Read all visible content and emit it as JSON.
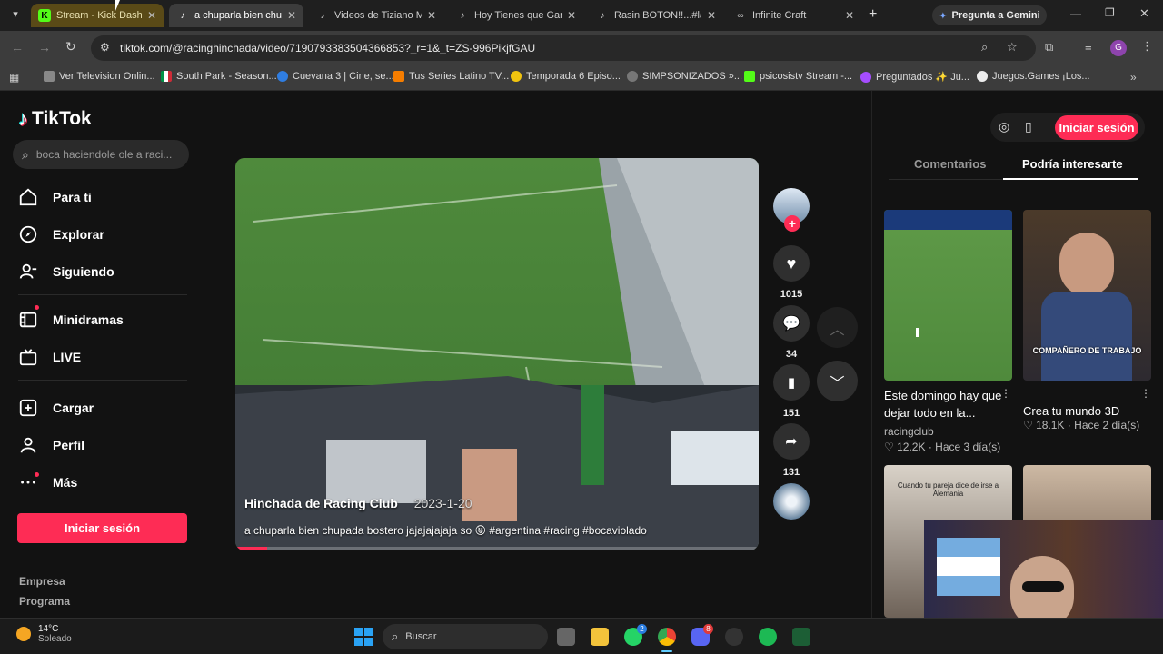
{
  "browser": {
    "tabs": [
      {
        "title": "Stream - Kick Dashbo",
        "icon": "kick-icon"
      },
      {
        "title": "a chuparla bien chup",
        "icon": "tiktok-icon"
      },
      {
        "title": "Videos de Tiziano M",
        "icon": "tiktok-icon"
      },
      {
        "title": "Hoy Tienes que Gana",
        "icon": "tiktok-icon"
      },
      {
        "title": "Rasin BOTON!!...#lat",
        "icon": "tiktok-icon"
      },
      {
        "title": "Infinite Craft",
        "icon": "infinite-craft-icon"
      }
    ],
    "gemini_label": "Pregunta a Gemini",
    "url": "tiktok.com/@racinghinchada/video/7190793383504366853?_r=1&_t=ZS-996PikjfGAU",
    "profile_letter": "G",
    "bookmarks": [
      "Ver Television Onlin...",
      "South Park - Season...",
      "Cuevana 3 | Cine, se...",
      "Tus Series Latino TV...",
      "Temporada 6 Episo...",
      "SIMPSONIZADOS »...",
      "psicosistv Stream -...",
      "Preguntados ✨ Ju...",
      "Juegos.Games ¡Los..."
    ]
  },
  "tiktok": {
    "logo": "TikTok",
    "search_placeholder": "boca haciendole ole a raci...",
    "nav": [
      {
        "label": "Para ti",
        "icon": "home-icon"
      },
      {
        "label": "Explorar",
        "icon": "compass-icon"
      },
      {
        "label": "Siguiendo",
        "icon": "following-icon"
      },
      {
        "label": "Minidramas",
        "icon": "film-icon"
      },
      {
        "label": "LIVE",
        "icon": "live-tv-icon"
      },
      {
        "label": "Cargar",
        "icon": "upload-plus-icon"
      },
      {
        "label": "Perfil",
        "icon": "profile-icon"
      },
      {
        "label": "Más",
        "icon": "more-dots-icon"
      }
    ],
    "login_label": "Iniciar sesión",
    "footer_links": [
      "Empresa",
      "Programa"
    ],
    "video": {
      "author": "Hinchada de Racing Club",
      "date": "2023-1-20",
      "caption": "a chuparla bien chupada bostero jajajajajaja so 😝 #argentina #racing #bocaviolado",
      "progress": 0.06
    },
    "actions": {
      "likes": "1015",
      "comments": "34",
      "saves": "151",
      "shares": "131"
    },
    "right_tabs": {
      "comments": "Comentarios",
      "suggested": "Podría interesarte"
    },
    "suggestions": [
      {
        "title": "Este domingo hay que dejar todo en la...",
        "author": "racingclub",
        "likes": "12.2K",
        "age": "Hace 3 día(s)",
        "overlay": ""
      },
      {
        "title": "Crea tu mundo 3D",
        "author": "",
        "likes": "18.1K",
        "age": "Hace 2 día(s)",
        "overlay": "COMPAÑERO DE TRABAJO"
      },
      {
        "title": "",
        "author": "",
        "likes": "",
        "age": "",
        "overlay": "Cuando tu pareja dice de irse a Alemania"
      },
      {
        "title": "",
        "author": "",
        "likes": "",
        "age": "",
        "overlay": ""
      }
    ]
  },
  "taskbar": {
    "temp": "14°C",
    "weather": "Soleado",
    "search_placeholder": "Buscar",
    "badges": {
      "whatsapp": "2",
      "discord": "8"
    }
  },
  "colors": {
    "accent": "#fe2c55",
    "page_bg": "#121212",
    "chrome_bg": "#3c3c3c",
    "tab_bar_bg": "#1f1f1f"
  }
}
